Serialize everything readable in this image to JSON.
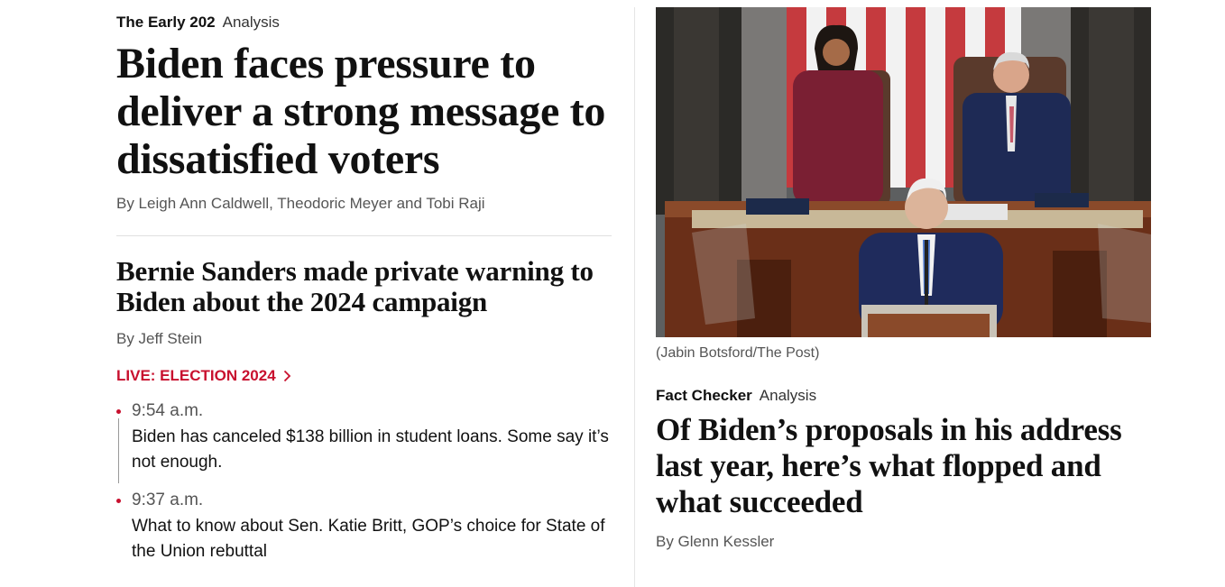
{
  "lead_story": {
    "section": "The Early 202",
    "label": "Analysis",
    "headline": "Biden faces pressure to deliver a strong message to dissatisfied voters",
    "byline": "By Leigh Ann Caldwell, Theodoric Meyer and Tobi Raji"
  },
  "second_story": {
    "headline": "Bernie Sanders made private warning to Biden about the 2024 campaign",
    "byline": "By Jeff Stein"
  },
  "live": {
    "label": "LIVE: ELECTION 2024",
    "items": [
      {
        "time": "9:54 a.m.",
        "text": "Biden has canceled $138 billion in student loans. Some say it’s not enough."
      },
      {
        "time": "9:37 a.m.",
        "text": "What to know about Sen. Katie Britt, GOP’s choice for State of the Union rebuttal"
      }
    ]
  },
  "photo": {
    "caption": "(Jabin Botsford/The Post)"
  },
  "right_story": {
    "section": "Fact Checker",
    "label": "Analysis",
    "headline": "Of Biden’s proposals in his address last year, here’s what flopped and what succeeded",
    "byline": "By Glenn Kessler"
  },
  "colors": {
    "accent_red": "#c8102e",
    "text": "#111111",
    "muted": "#555555"
  }
}
